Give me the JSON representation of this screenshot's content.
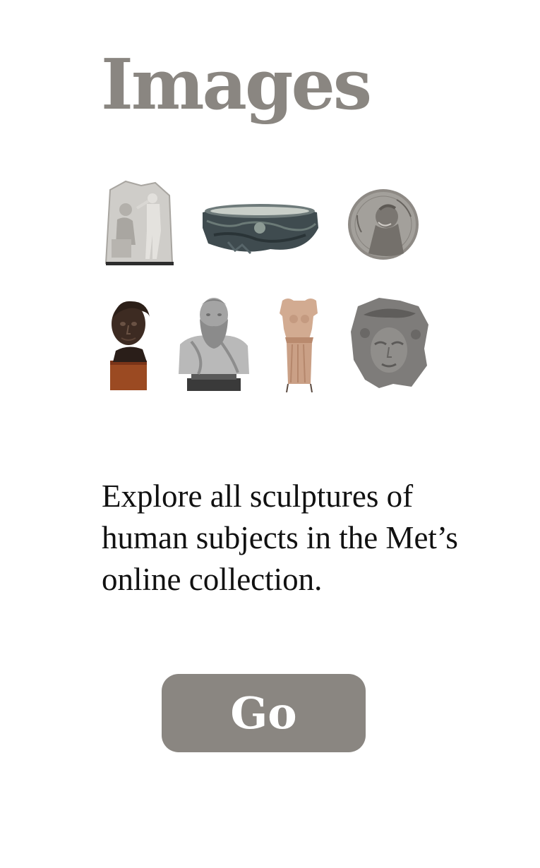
{
  "page": {
    "title": "Images",
    "description": "Explore all sculptures of human subjects in the Met’s online collection.",
    "go_label": "Go"
  },
  "thumbnails": [
    {
      "name": "relief-seated-figure",
      "tone": "#c9c7c3"
    },
    {
      "name": "bronze-bowl-fragment",
      "tone": "#3d4a4e"
    },
    {
      "name": "bronze-portrait-medal",
      "tone": "#8e8a85"
    },
    {
      "name": "dark-bronze-bust",
      "tone": "#3b2a22"
    },
    {
      "name": "bearded-marble-bust",
      "tone": "#9b9b9b"
    },
    {
      "name": "stone-female-torso",
      "tone": "#c69d82"
    },
    {
      "name": "stone-head-fragment",
      "tone": "#7a7876"
    }
  ],
  "colors": {
    "title": "#8a8681",
    "button_bg": "#8a8681",
    "button_text": "#ffffff",
    "text": "#111111"
  }
}
